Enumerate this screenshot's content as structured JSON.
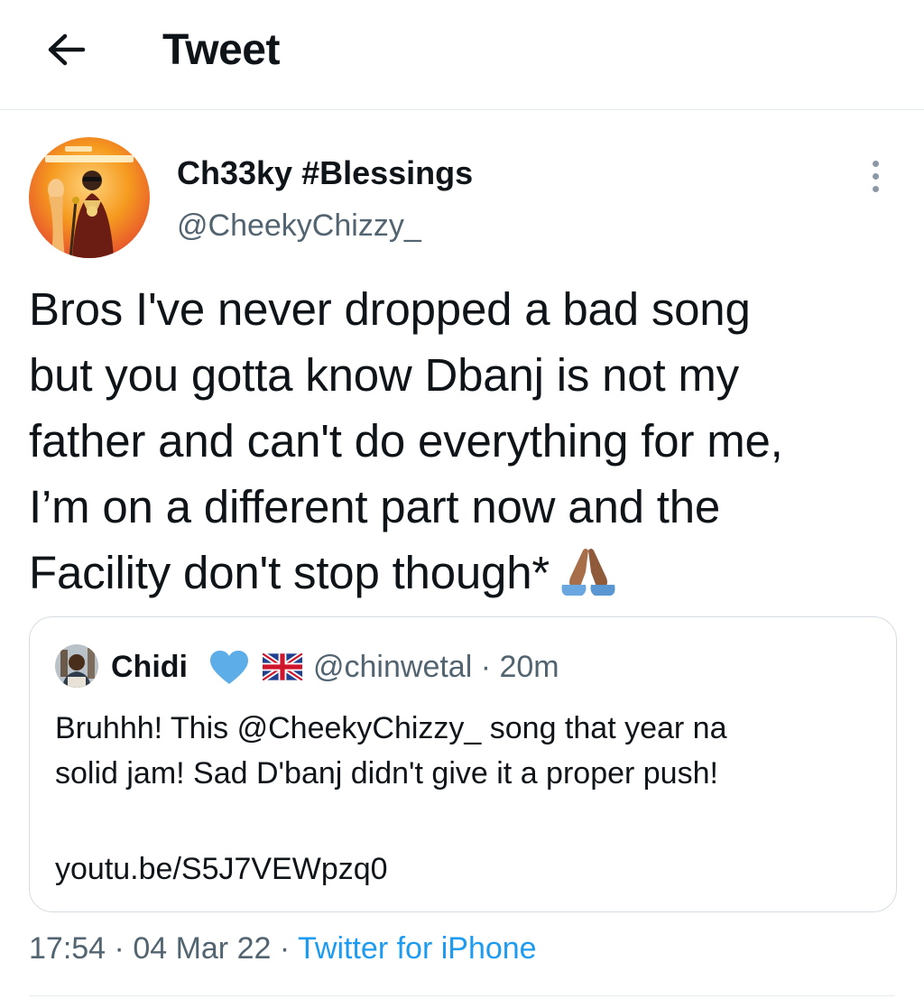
{
  "header": {
    "title": "Tweet",
    "back_icon": "arrow-left-icon"
  },
  "tweet": {
    "author": {
      "display_name": "Ch33ky #Blessings",
      "handle": "@CheekyChizzy_",
      "avatar_colors": [
        "#f59a1f",
        "#e8562c",
        "#fff4cf"
      ]
    },
    "text_lines": [
      "Bros I've never dropped a bad song",
      "but you gotta know Dbanj is not my",
      "father and can't do everything for me,",
      "I’m on a different part now and the",
      "Facility don't stop though*"
    ],
    "emoji": "folded-hands-icon",
    "timestamp": "17:54",
    "date": "04 Mar 22",
    "source": "Twitter for iPhone",
    "separator": " · "
  },
  "quoted_tweet": {
    "name": "Chidi",
    "badge_icon": "blue-heart-icon",
    "flag_icon": "uk-flag-icon",
    "handle_time": "@chinwetal · 20m",
    "body_lines": [
      "Bruhhh! This @CheekyChizzy_ song that year na",
      "solid jam! Sad D'banj didn't give it a proper push!"
    ],
    "link": "youtu.be/S5J7VEWpzq0"
  },
  "colors": {
    "text": "#0f1419",
    "secondary": "#536471",
    "link": "#1d9bf0",
    "divider": "#e6ecf0",
    "heart": "#5dade8"
  }
}
